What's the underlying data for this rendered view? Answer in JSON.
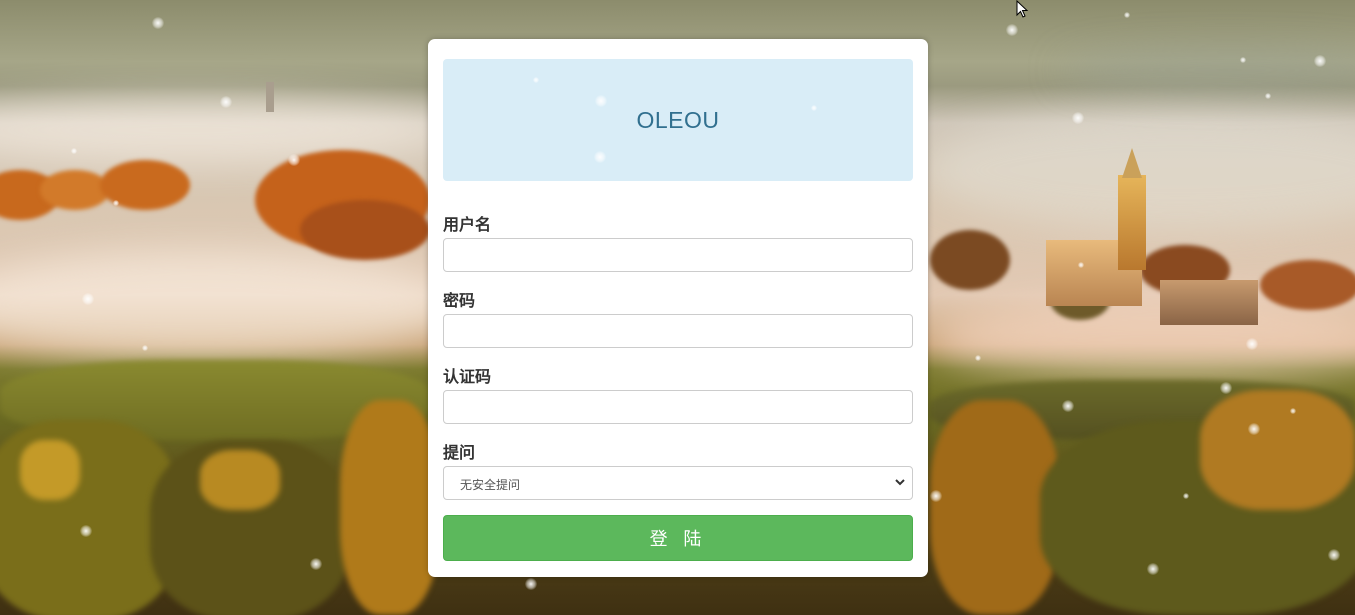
{
  "banner": {
    "title": "OLEOU"
  },
  "form": {
    "username_label": "用户名",
    "username_value": "",
    "password_label": "密码",
    "password_value": "",
    "auth_code_label": "认证码",
    "auth_code_value": "",
    "question_label": "提问",
    "question_selected": "无安全提问",
    "login_button": "登 陆"
  },
  "colors": {
    "banner_bg": "#d9edf7",
    "banner_text": "#31708f",
    "login_button_bg": "#5cb85c"
  },
  "icons": {
    "select_arrow": "chevron-down-icon",
    "cursor": "mouse-cursor-icon"
  }
}
